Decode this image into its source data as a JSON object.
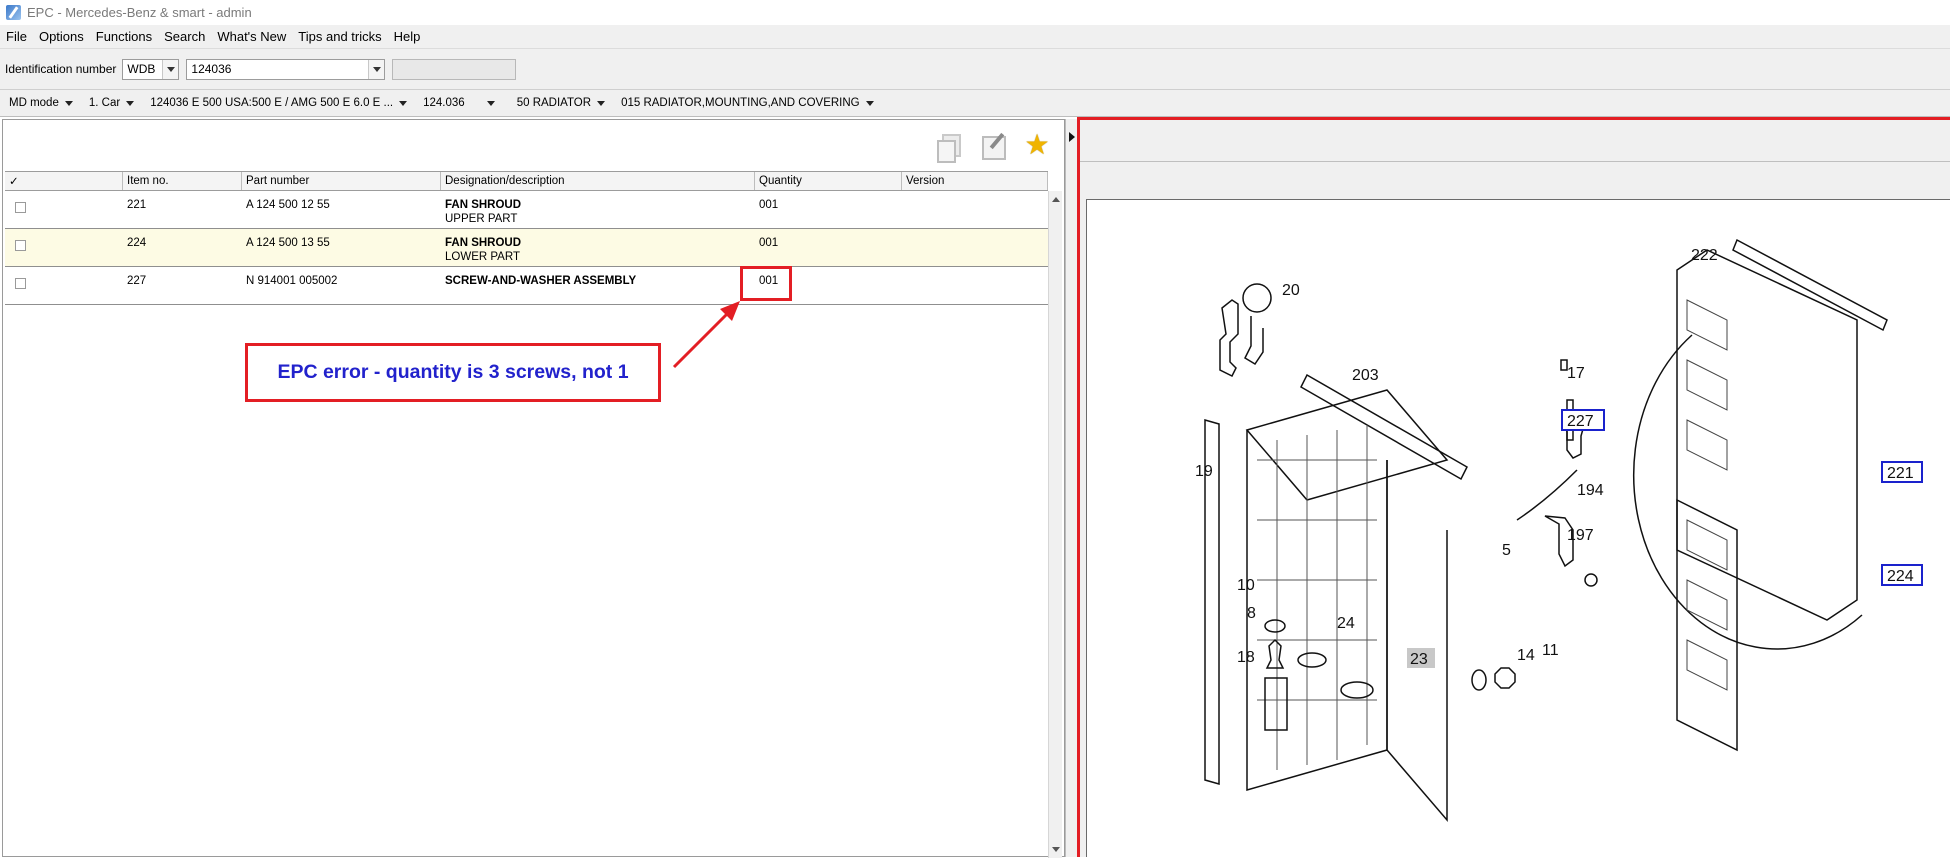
{
  "window": {
    "title": "EPC - Mercedes-Benz & smart - admin"
  },
  "menu": [
    "File",
    "Options",
    "Functions",
    "Search",
    "What's New",
    "Tips and tricks",
    "Help"
  ],
  "ident": {
    "label": "Identification number",
    "prefix": "WDB",
    "number": "124036"
  },
  "crumbs": [
    "MD mode",
    "1. Car",
    "124036 E 500 USA:500 E / AMG 500 E 6.0 E ...",
    "124.036",
    "50 RADIATOR",
    "015 RADIATOR,MOUNTING,AND COVERING"
  ],
  "grid": {
    "headers": {
      "check": "✓",
      "item": "Item no.",
      "part": "Part number",
      "desc": "Designation/description",
      "qty": "Quantity",
      "version": "Version"
    },
    "rows": [
      {
        "item": "221",
        "part": "A 124 500 12 55",
        "desc": "FAN SHROUD",
        "desc_sub": "UPPER PART",
        "qty": "001"
      },
      {
        "item": "224",
        "part": "A 124 500 13 55",
        "desc": "FAN SHROUD",
        "desc_sub": "LOWER PART",
        "qty": "001"
      },
      {
        "item": "227",
        "part": "N 914001 005002",
        "desc": "SCREW-AND-WASHER ASSEMBLY",
        "desc_sub": "",
        "qty": "001"
      }
    ]
  },
  "annotation": {
    "text": "EPC error - quantity is 3 screws, not 1",
    "color": "#e31e24",
    "text_color": "#2222cc"
  },
  "drawing": {
    "labels": {
      "l20": "20",
      "l222": "222",
      "l203": "203",
      "l17": "17",
      "l227": "227",
      "l19": "19",
      "l221": "221",
      "l194": "194",
      "l197": "197",
      "l5": "5",
      "l224": "224",
      "l10": "10",
      "l8": "8",
      "l24": "24",
      "l14": "14",
      "l11": "11",
      "l18": "18",
      "l23": "23"
    }
  }
}
